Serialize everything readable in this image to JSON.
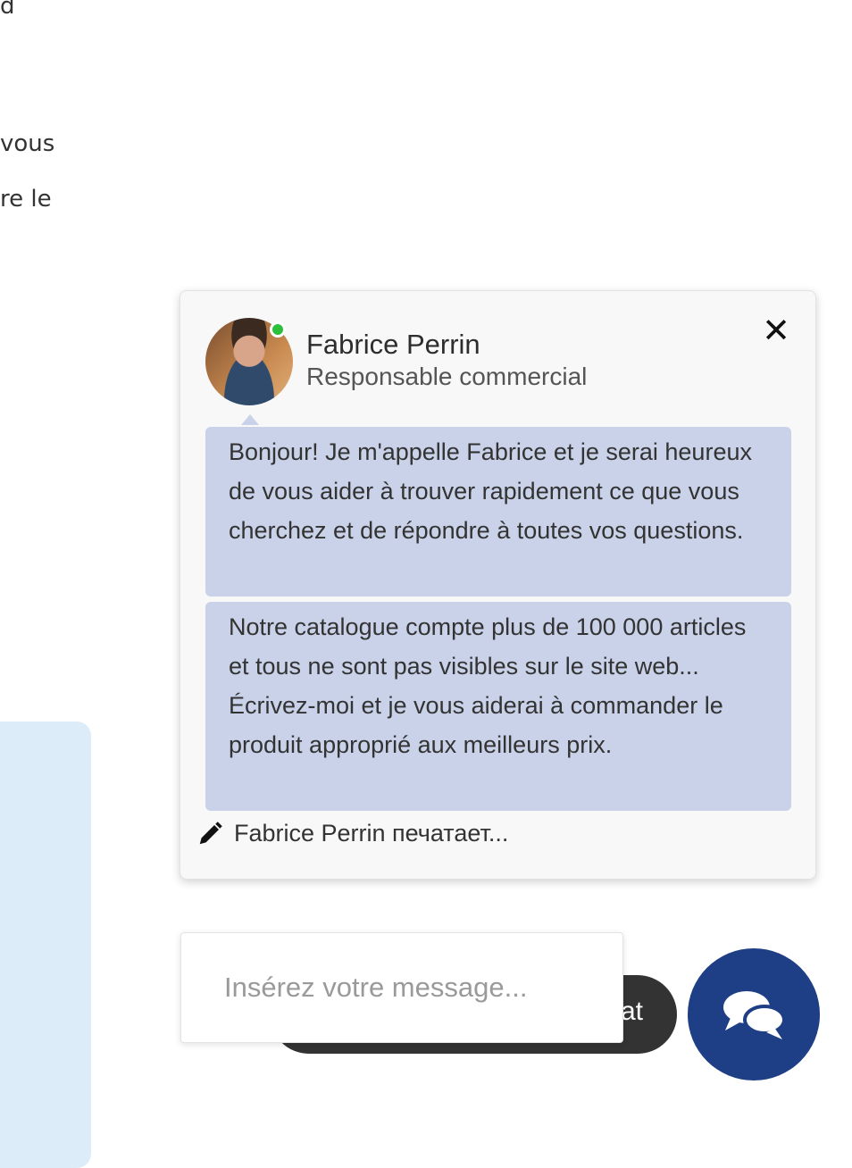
{
  "background": {
    "fragments": [
      "d",
      "vous",
      "re le"
    ]
  },
  "chat": {
    "agent": {
      "name": "Fabrice Perrin",
      "role": "Responsable commercial",
      "status": "online"
    },
    "messages": [
      "Bonjour! Je m'appelle Fabrice et je serai heureux de vous aider à trouver rapidement ce que vous cherchez et de répondre à toutes vos questions.",
      "Notre catalogue compte plus de 100 000 articles et tous ne sont pas visibles sur le site web... Écrivez-moi et je vous aiderai à commander le produit approprié aux meilleurs prix."
    ],
    "typing_indicator": "Fabrice Perrin печатает...",
    "close_symbol": "✕",
    "input_placeholder": "Insérez votre message...",
    "pill_label_fragment": "at",
    "colors": {
      "bubble": "#c9d2e8",
      "launcher": "#1e3f86",
      "online": "#2bbf3c"
    },
    "icons": [
      "close-icon",
      "pencil-icon",
      "chat-bubbles-icon"
    ]
  }
}
